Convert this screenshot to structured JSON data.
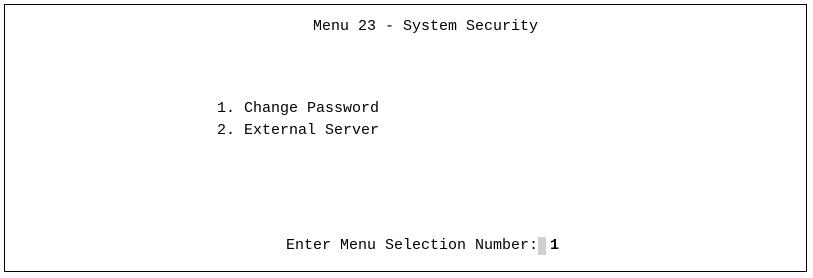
{
  "screen": {
    "title": "Menu 23 - System Security"
  },
  "menu": {
    "items": [
      {
        "label": "1. Change Password"
      },
      {
        "label": "2. External Server"
      }
    ]
  },
  "prompt": {
    "label": "Enter Menu Selection Number:",
    "value": "1"
  },
  "colors": {
    "background": "#ffffff",
    "text": "#000000",
    "border": "#000000",
    "cursor": "#d0d0d0"
  }
}
